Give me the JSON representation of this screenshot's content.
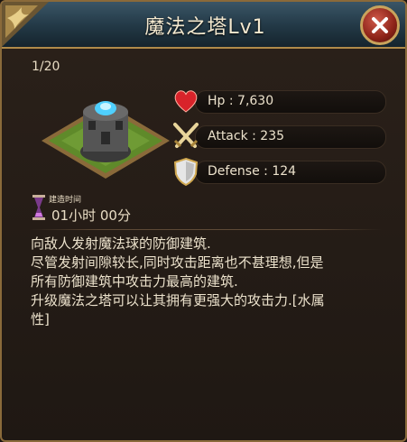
{
  "header": {
    "title": "魔法之塔Lv1"
  },
  "progress": "1/20",
  "stats": {
    "hp": "Hp : 7,630",
    "attack": "Attack : 235",
    "defense": "Defense : 124"
  },
  "build": {
    "label": "建造时间",
    "time": "01小时 00分"
  },
  "description": [
    "向敌人发射魔法球的防御建筑.",
    "尽管发射间隙较长,同时攻击距离也不甚理想,但是",
    "所有防御建筑中攻击力最高的建筑.",
    "升级魔法之塔可以让其拥有更强大的攻击力.[水属",
    "性]"
  ],
  "colors": {
    "accent_gold": "#c9a35c",
    "close_red": "#8c2318",
    "heart": "#d8232a"
  }
}
